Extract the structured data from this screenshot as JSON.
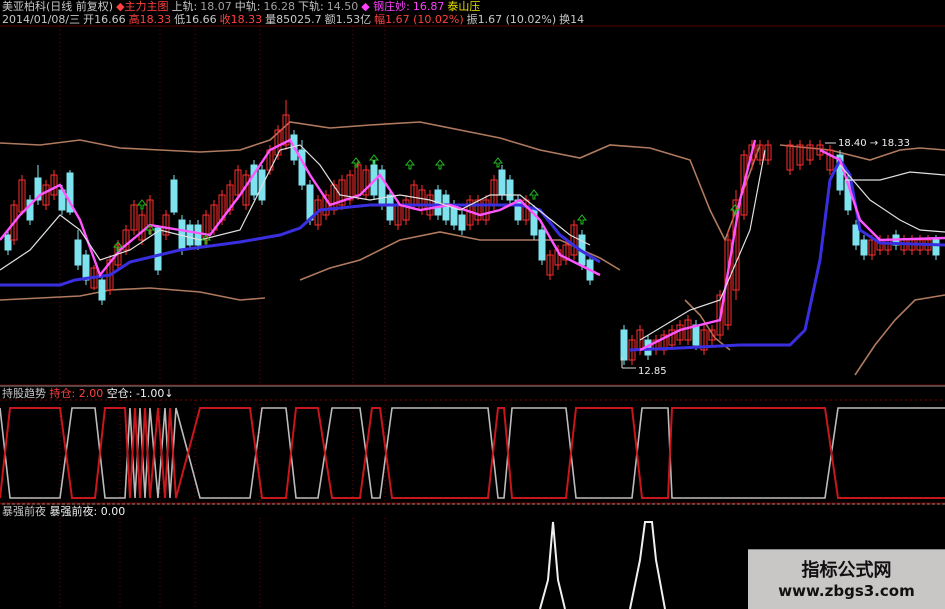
{
  "header": {
    "row1": [
      {
        "text": "美亚柏科(日线 前复权)",
        "color": "#c8c8c8"
      },
      {
        "text": "◆主力主图",
        "color": "#ff4040"
      },
      {
        "text": "上轨:",
        "color": "#c8c8c8"
      },
      {
        "text": "18.07",
        "color": "#a0a0a0"
      },
      {
        "text": "中轨:",
        "color": "#c8c8c8"
      },
      {
        "text": "16.28",
        "color": "#a0a0a0"
      },
      {
        "text": "下轨:",
        "color": "#c8c8c8"
      },
      {
        "text": "14.50",
        "color": "#a0a0a0"
      },
      {
        "text": "◆ 钢庄妙:",
        "color": "#ff40ff"
      },
      {
        "text": "16.87",
        "color": "#ff40ff"
      },
      {
        "text": "泰山压",
        "color": "#e8e000"
      }
    ],
    "row2": [
      {
        "text": "2014/01/08/三",
        "color": "#c8c8c8"
      },
      {
        "text": "开16.66",
        "color": "#c8c8c8"
      },
      {
        "text": "高18.33",
        "color": "#ff4040"
      },
      {
        "text": "低16.66",
        "color": "#c8c8c8"
      },
      {
        "text": "收18.33",
        "color": "#ff4040"
      },
      {
        "text": "量85025.7",
        "color": "#c8c8c8"
      },
      {
        "text": "额1.53亿",
        "color": "#c8c8c8"
      },
      {
        "text": "幅1.67 (10.02%)",
        "color": "#ff4040"
      },
      {
        "text": "振1.67 (10.02%)",
        "color": "#c8c8c8"
      },
      {
        "text": "换14",
        "color": "#c8c8c8"
      }
    ]
  },
  "panel2": {
    "title": "持股趋势",
    "label1": "持仓:",
    "value1": "2.00",
    "label2": "空仓:",
    "value2": "-1.00"
  },
  "panel3": {
    "title": "暴强前夜",
    "label": "暴强前夜:",
    "value": "0.00"
  },
  "annotations": {
    "high_price": "18.40 → 18.33",
    "low_price": "12.85"
  },
  "watermark": {
    "title": "指标公式网",
    "url": "www.zbgs3.com"
  },
  "colors": {
    "up_candle": "#ff3030",
    "down_candle": "#7fe3ef",
    "ma_magenta": "#ff55ff",
    "ma_white": "#e0e0e0",
    "trend_blue": "#3a2fe0",
    "band": "#b07a5e",
    "hold_line": "#c8161d",
    "empty_line": "#bcbcbc",
    "grid": "#800000",
    "arrow_green": "#20c020"
  },
  "chart_data": {
    "type": "line",
    "series": []
  }
}
